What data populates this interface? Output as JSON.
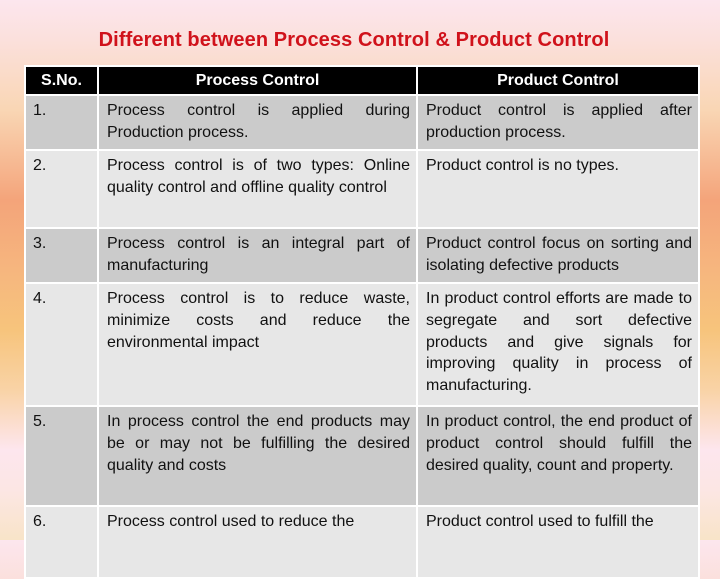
{
  "title": "Different between Process Control & Product Control",
  "table": {
    "headers": {
      "sno": "S.No.",
      "process": "Process Control",
      "product": "Product Control"
    },
    "rows": [
      {
        "sno": "1.",
        "process": "Process control is applied during Production process.",
        "product": "Product control is applied after production process."
      },
      {
        "sno": "2.",
        "process": "Process control is of two types: Online quality control and offline quality control",
        "product": "Product control is no types."
      },
      {
        "sno": "3.",
        "process": "Process control is an integral part of manufacturing",
        "product": "Product control focus on sorting and isolating defective products"
      },
      {
        "sno": "4.",
        "process": "Process control is to reduce waste, minimize costs and reduce the environmental impact",
        "product": "In product control efforts are made to segregate and sort defective products and give signals for improving quality in process of manufacturing."
      },
      {
        "sno": "5.",
        "process": "In process control the end products may be or may not be fulfilling the desired quality and costs",
        "product": "In product control, the end product of product control should fulfill the desired quality, count and property."
      },
      {
        "sno": "6.",
        "process": "Process control used to reduce the",
        "product": "Product control used to fulfill the"
      }
    ]
  },
  "colors": {
    "title": "#d0121b",
    "header_bg": "#000000",
    "header_text": "#ffffff",
    "row_dark": "#cbcbcb",
    "row_light": "#e7e7e7"
  }
}
